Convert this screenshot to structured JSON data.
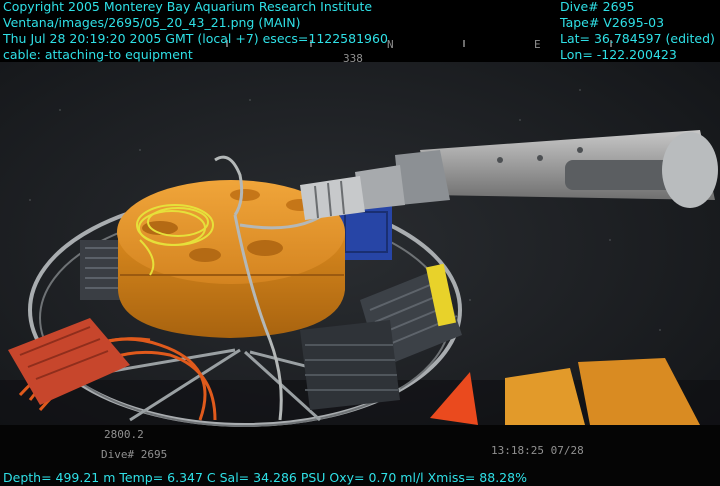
{
  "overlay": {
    "copyright": "Copyright 2005 Monterey Bay Aquarium Research Institute",
    "image_path": "Ventana/images/2695/05_20_43_21.png (MAIN)",
    "datetime": "Thu Jul 28 20:19:20 2005 GMT (local +7)  esecs=1122581960",
    "annotation": "cable: attaching-to equipment",
    "dive": "Dive# 2695",
    "tape": "Tape# V2695-03",
    "lat": "Lat= 36.784597 (edited)",
    "lon": "Lon= -122.200423",
    "sensors": "Depth= 499.21 m  Temp= 6.347 C  Sal= 34.286 PSU  Oxy= 0.70 ml/l  Xmiss= 88.28%"
  },
  "camera_overlay": {
    "compass_n": "N",
    "compass_e": "E",
    "heading": "338",
    "depth_readout": "2800.2",
    "dive_label": "Dive# 2695",
    "timestamp": "13:18:25 07/28"
  },
  "colors": {
    "overlay_text": "#2fe0e6",
    "deep_water": "#1d2024",
    "orange_float": "#e0922a",
    "manipulator_arm": "#9a9a9a"
  }
}
